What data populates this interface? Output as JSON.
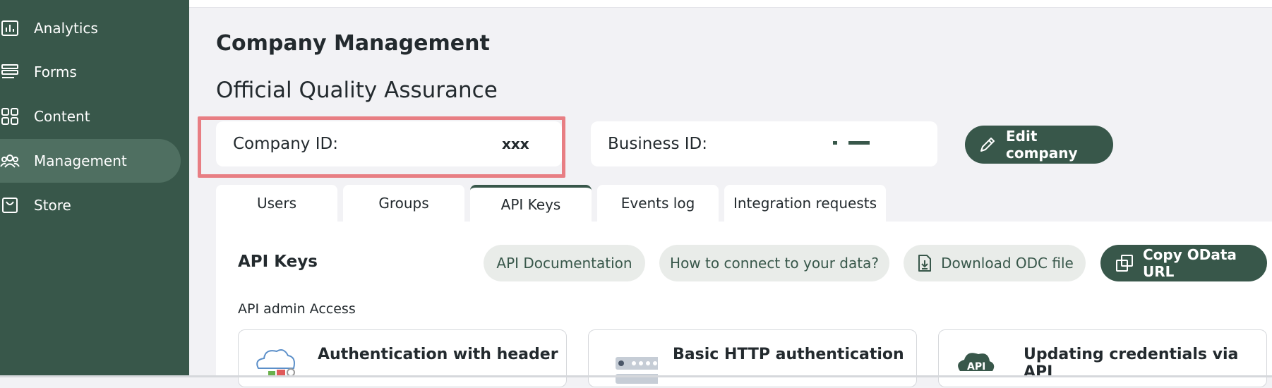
{
  "sidebar": {
    "items": [
      {
        "label": "Analytics",
        "icon": "analytics-icon",
        "active": false
      },
      {
        "label": "Forms",
        "icon": "forms-icon",
        "active": false
      },
      {
        "label": "Content",
        "icon": "content-icon",
        "active": false
      },
      {
        "label": "Management",
        "icon": "people-icon",
        "active": true
      },
      {
        "label": "Store",
        "icon": "store-icon",
        "active": false
      }
    ]
  },
  "header": {
    "title": "Company Management",
    "company_name": "Official Quality Assurance"
  },
  "company": {
    "id_label": "Company ID:",
    "id_value": "xxx",
    "business_id_label": "Business ID:",
    "edit_label": "Edit company"
  },
  "tabs": [
    {
      "label": "Users",
      "active": false
    },
    {
      "label": "Groups",
      "active": false
    },
    {
      "label": "API Keys",
      "active": true
    },
    {
      "label": "Events log",
      "active": false
    },
    {
      "label": "Integration requests",
      "active": false
    }
  ],
  "api_keys": {
    "title": "API Keys",
    "buttons": {
      "docs": "API Documentation",
      "connect": "How to connect to your data?",
      "download": "Download ODC file",
      "copy": "Copy OData URL"
    },
    "admin_access_label": "API admin Access",
    "cards": [
      {
        "title": "Authentication with header",
        "icon": "cloud-lock-icon"
      },
      {
        "title": "Basic HTTP authentication",
        "icon": "password-icon"
      },
      {
        "title": "Updating credentials via API",
        "icon": "api-cloud-icon"
      }
    ]
  },
  "colors": {
    "sidebar": "#38574a",
    "accent": "#38574a",
    "highlight": "#e87e83",
    "background": "#f2f2f5"
  }
}
